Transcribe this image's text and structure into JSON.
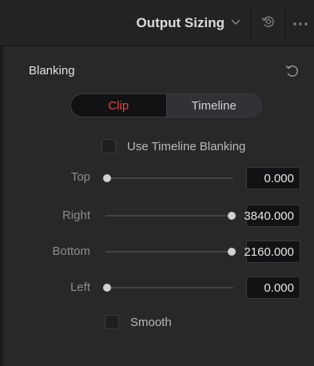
{
  "header": {
    "title": "Output Sizing",
    "icons": {
      "chevron": "chevron-down-icon",
      "keyframe": "keyframe-icon",
      "more": "more-options-icon"
    }
  },
  "blanking": {
    "title": "Blanking",
    "reset_icon": "reset-icon",
    "tabs": [
      {
        "label": "Clip",
        "active": true
      },
      {
        "label": "Timeline",
        "active": false
      }
    ],
    "use_timeline_blanking": {
      "label": "Use Timeline Blanking",
      "checked": false
    },
    "params": [
      {
        "label": "Top",
        "value": "0.000",
        "slider_fraction": 0
      },
      {
        "label": "Right",
        "value": "3840.000",
        "slider_fraction": 1
      },
      {
        "label": "Bottom",
        "value": "2160.000",
        "slider_fraction": 1
      },
      {
        "label": "Left",
        "value": "0.000",
        "slider_fraction": 0
      }
    ],
    "smooth": {
      "label": "Smooth",
      "checked": false
    }
  },
  "colors": {
    "active_tab_text": "#e8453c",
    "panel_bg": "#282829",
    "header_bg": "#232326"
  }
}
